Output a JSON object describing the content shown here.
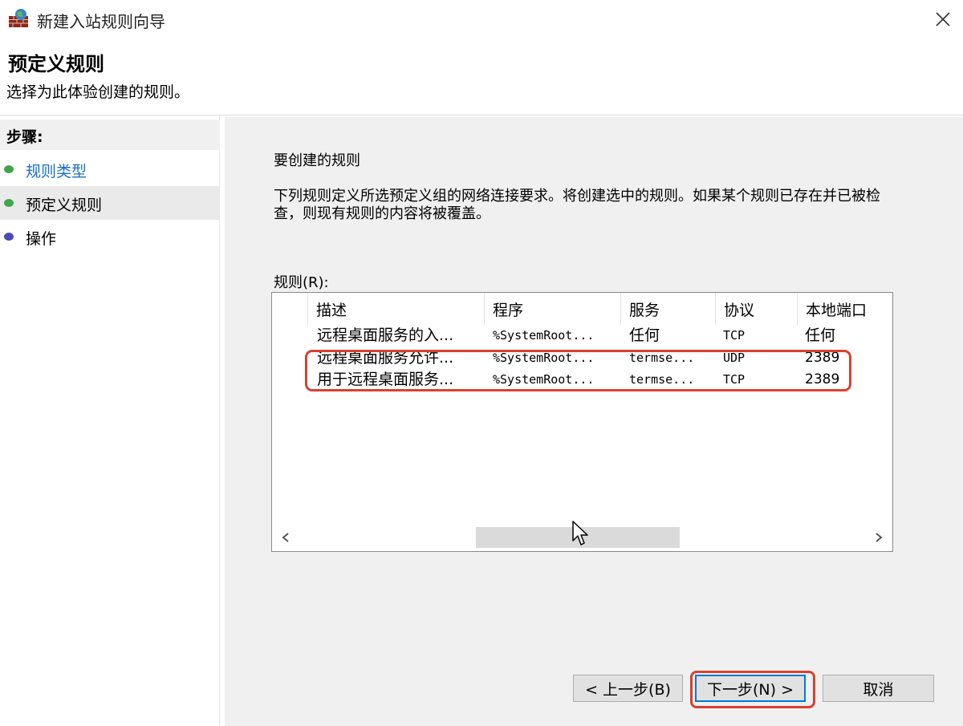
{
  "window": {
    "title": "新建入站规则向导",
    "close_icon": "close-icon"
  },
  "header": {
    "title": "预定义规则",
    "subtitle": "选择为此体验创建的规则。"
  },
  "sidebar": {
    "heading": "步骤:",
    "steps": [
      {
        "label": "规则类型",
        "state": "link",
        "dot_color": "#3fa64a"
      },
      {
        "label": "预定义规则",
        "state": "current",
        "dot_color": "#3fa64a"
      },
      {
        "label": "操作",
        "state": "pending",
        "dot_color": "#4a4ab8"
      }
    ]
  },
  "main": {
    "section_title": "要创建的规则",
    "description": "下列规则定义所选预定义组的网络连接要求。将创建选中的规则。如果某个规则已存在并已被检查，则现有规则的内容将被覆盖。",
    "rules_label": "规则(R):",
    "columns": [
      "描述",
      "程序",
      "服务",
      "协议",
      "本地端口"
    ],
    "rows": [
      {
        "desc": "远程桌面服务的入...",
        "program": "%SystemRoot...",
        "service": "任何",
        "protocol": "TCP",
        "port": "任何",
        "checked": false
      },
      {
        "desc": "远程桌面服务允许...",
        "program": "%SystemRoot...",
        "service": "termse...",
        "protocol": "UDP",
        "port": "2389",
        "checked": false
      },
      {
        "desc": "用于远程桌面服务...",
        "program": "%SystemRoot...",
        "service": "termse...",
        "protocol": "TCP",
        "port": "2389",
        "checked": false
      }
    ]
  },
  "buttons": {
    "back": "< 上一步(B)",
    "next": "下一步(N) >",
    "cancel": "取消"
  },
  "colors": {
    "highlight": "#d9412e",
    "link": "#1a6fc4",
    "content_bg": "#f0f0f0",
    "focus_border": "#0078d7"
  }
}
